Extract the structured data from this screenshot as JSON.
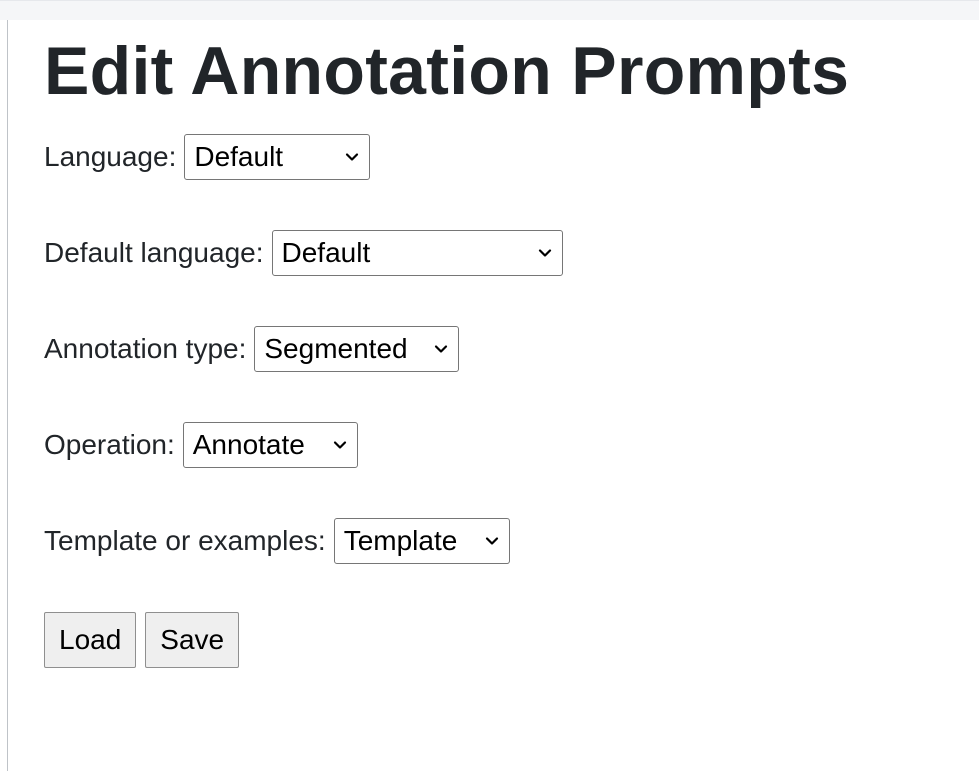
{
  "page": {
    "title": "Edit Annotation Prompts"
  },
  "form": {
    "language": {
      "label": "Language:",
      "value": "Default"
    },
    "default_language": {
      "label": "Default language:",
      "value": "Default"
    },
    "annotation_type": {
      "label": "Annotation type:",
      "value": "Segmented"
    },
    "operation": {
      "label": "Operation:",
      "value": "Annotate"
    },
    "template_or_examples": {
      "label": "Template or examples:",
      "value": "Template"
    }
  },
  "buttons": {
    "load": "Load",
    "save": "Save"
  },
  "icons": {
    "select_chevron": "chevron-down-icon"
  }
}
